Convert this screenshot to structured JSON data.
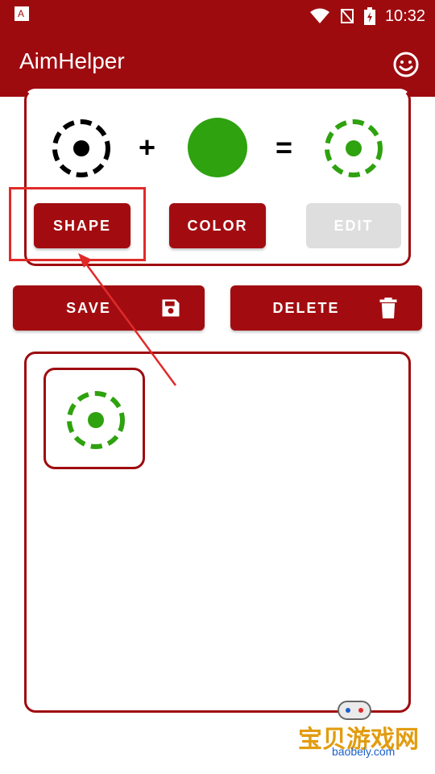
{
  "status": {
    "time": "10:32"
  },
  "app": {
    "title": "AimHelper"
  },
  "combo": {
    "plus": "+",
    "equals": "="
  },
  "colors": {
    "primary": "#9e0b0f",
    "accent_green": "#2ea20f",
    "disabled": "#dedede"
  },
  "buttons": {
    "shape": "SHAPE",
    "color": "COLOR",
    "edit": "EDIT",
    "save": "SAVE",
    "delete": "DELETE"
  },
  "watermark": {
    "cn": "宝贝游戏网",
    "en": "baobeiy.com"
  }
}
